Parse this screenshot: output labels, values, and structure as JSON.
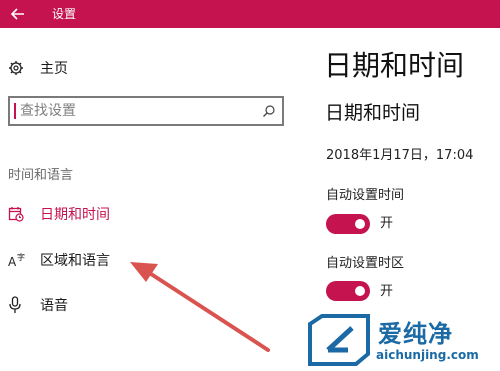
{
  "window": {
    "title": "设置"
  },
  "sidebar": {
    "home_label": "主页",
    "search": {
      "placeholder": "查找设置"
    },
    "section_heading": "时间和语言",
    "items": [
      {
        "label": "日期和时间",
        "icon": "calendar-clock-icon",
        "selected": true
      },
      {
        "label": "区域和语言",
        "icon": "language-icon",
        "selected": false
      },
      {
        "label": "语音",
        "icon": "microphone-icon",
        "selected": false
      }
    ]
  },
  "main": {
    "page_title": "日期和时间",
    "sub_title": "日期和时间",
    "current_datetime": "2018年1月17日，17:04",
    "settings": [
      {
        "label": "自动设置时间",
        "state": "开",
        "on": true
      },
      {
        "label": "自动设置时区",
        "state": "开",
        "on": true
      }
    ]
  },
  "watermark": {
    "text_cn": "爱纯净",
    "url": "aichunjing.com"
  },
  "colors": {
    "accent": "#c4134f",
    "watermark": "#1b6aa5",
    "annotation_arrow": "#d9534f"
  }
}
